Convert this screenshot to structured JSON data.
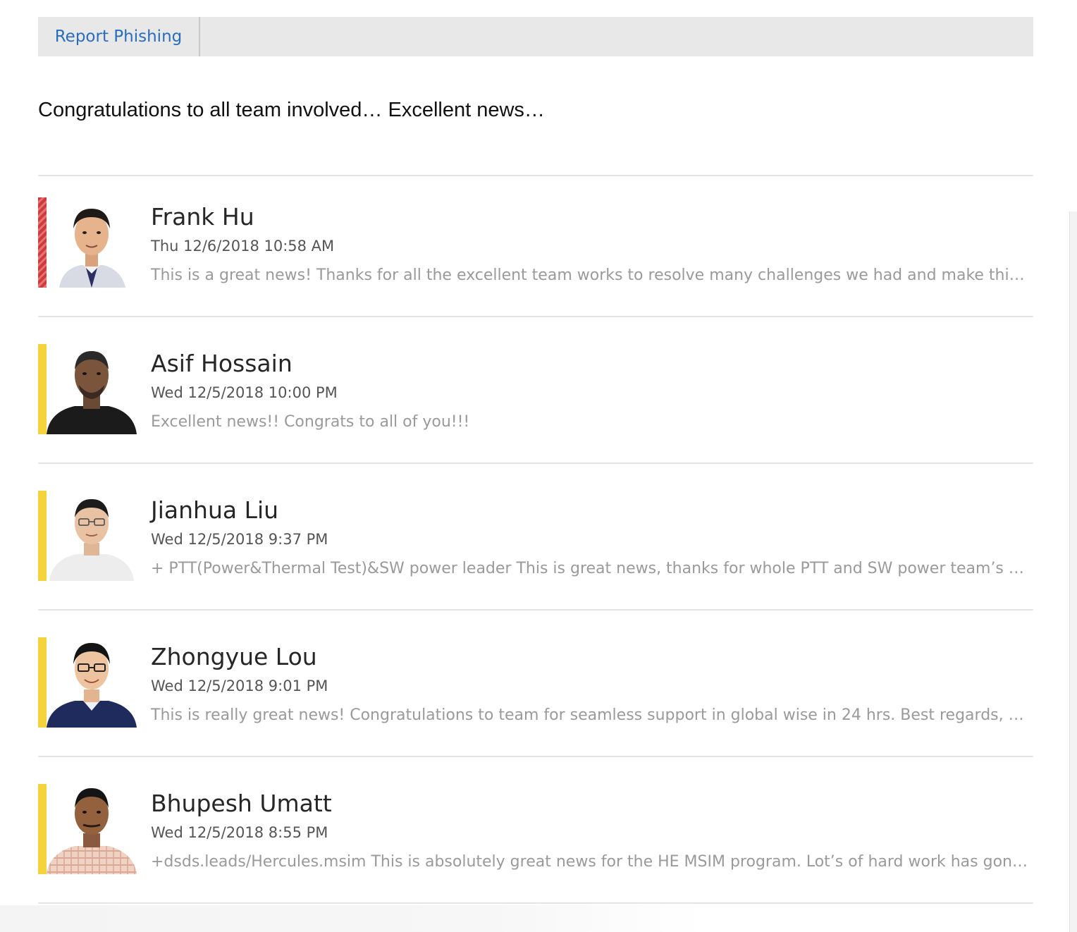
{
  "toolbar": {
    "report_phishing_label": "Report Phishing"
  },
  "message": {
    "body": "Congratulations to all team involved… Excellent news…"
  },
  "replies": [
    {
      "name": "Frank Hu",
      "date": "Thu 12/6/2018 10:58 AM",
      "preview": "This is a great news! Thanks for all the excellent team works to resolve many challenges we had and make this happe...",
      "category_color": "#d13a3a"
    },
    {
      "name": "Asif Hossain",
      "date": "Wed 12/5/2018 10:00 PM",
      "preview": "Excellent news!! Congrats to all of you!!!",
      "category_color": "#f5d33c"
    },
    {
      "name": "Jianhua Liu",
      "date": "Wed 12/5/2018 9:37 PM",
      "preview": "+ PTT(Power&Thermal Test)&SW power leader This is great news, thanks for whole PTT and SW power team’s great s...",
      "category_color": "#f5d33c"
    },
    {
      "name": "Zhongyue Lou",
      "date": "Wed 12/5/2018 9:01 PM",
      "preview": "This is really great news! Congratulations to team for seamless support in global wise in 24 hrs. Best regards, Lou Zh...",
      "category_color": "#f5d33c"
    },
    {
      "name": "Bhupesh Umatt",
      "date": "Wed 12/5/2018 8:55 PM",
      "preview": "+dsds.leads/Hercules.msim This is absolutely great news for the HE MSIM program. Lot’s of hard work has gone into ...",
      "category_color": "#f5d33c"
    }
  ]
}
